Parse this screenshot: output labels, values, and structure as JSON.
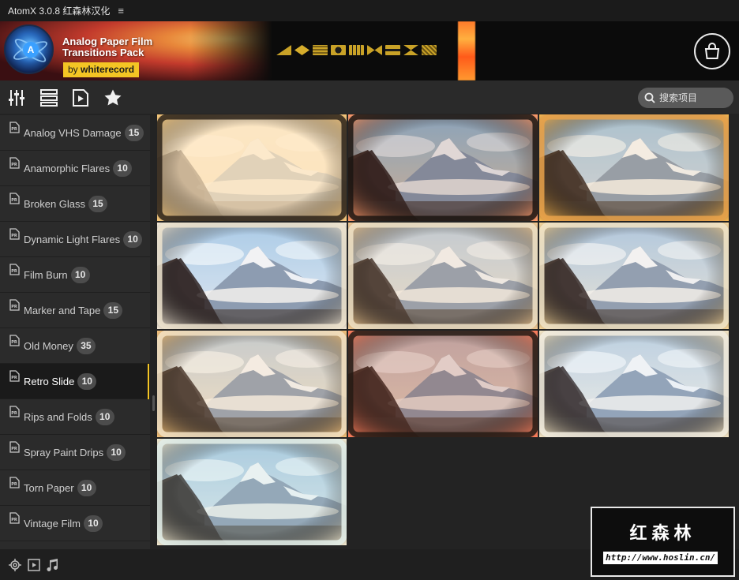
{
  "app": {
    "title": "AtomX  3.0.8 红森林汉化",
    "menu_glyph": "≡"
  },
  "banner": {
    "title_line1": "Analog Paper Film",
    "title_line2": "Transitions Pack",
    "by_prefix": "by ",
    "by_author": "whiterecord",
    "logo_letter": "A"
  },
  "toolbar": {
    "search_placeholder": "搜索项目"
  },
  "sidebar": {
    "items": [
      {
        "label": "Analog VHS Damage",
        "count": "15"
      },
      {
        "label": "Anamorphic Flares",
        "count": "10"
      },
      {
        "label": "Broken Glass",
        "count": "15"
      },
      {
        "label": "Dynamic Light Flares",
        "count": "10"
      },
      {
        "label": "Film Burn",
        "count": "10"
      },
      {
        "label": "Marker and Tape",
        "count": "15"
      },
      {
        "label": "Old Money",
        "count": "35"
      },
      {
        "label": "Retro Slide",
        "count": "10"
      },
      {
        "label": "Rips and Folds",
        "count": "10"
      },
      {
        "label": "Spray Paint Drips",
        "count": "10"
      },
      {
        "label": "Torn Paper",
        "count": "10"
      },
      {
        "label": "Vintage Film",
        "count": "10"
      }
    ],
    "active_index": 7
  },
  "grid": {
    "count": 10
  },
  "watermark": {
    "title": "红森林",
    "url": "http://www.hoslin.cn/"
  },
  "colors": {
    "accent": "#f4c524",
    "background": "#232323",
    "sidebar": "#2b2b2b"
  }
}
